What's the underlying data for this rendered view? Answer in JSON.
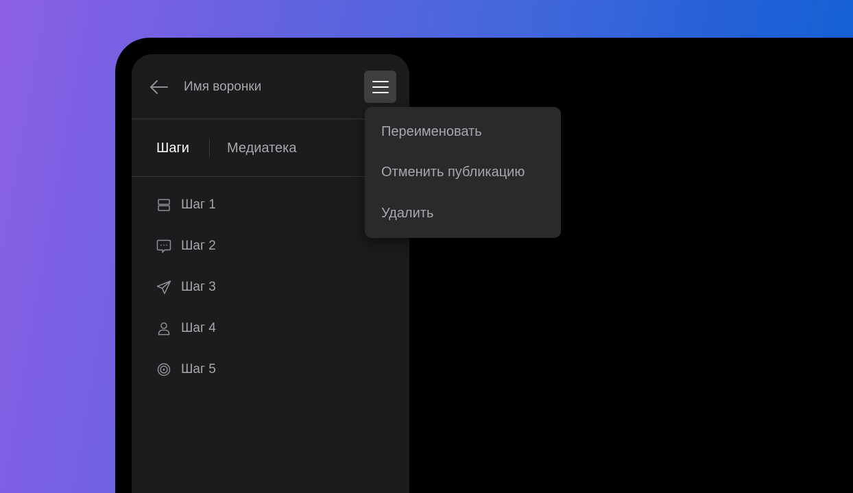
{
  "header": {
    "back_icon": "arrow-left-icon",
    "title": "Имя воронки",
    "menu_icon": "hamburger-menu-icon"
  },
  "tabs": [
    {
      "label": "Шаги",
      "active": true
    },
    {
      "label": "Медиатека",
      "active": false
    }
  ],
  "steps": [
    {
      "label": "Шаг 1",
      "icon": "layout-rows-icon"
    },
    {
      "label": "Шаг 2",
      "icon": "chat-bubble-icon"
    },
    {
      "label": "Шаг 3",
      "icon": "paper-plane-icon"
    },
    {
      "label": "Шаг 4",
      "icon": "user-icon"
    },
    {
      "label": "Шаг 5",
      "icon": "target-icon"
    }
  ],
  "menu": {
    "items": [
      {
        "label": "Переименовать"
      },
      {
        "label": "Отменить публикацию"
      },
      {
        "label": "Удалить"
      }
    ]
  },
  "colors": {
    "background_gradient_start": "#8c5fe6",
    "background_gradient_end": "#0b62d2",
    "panel": "#1c1c1e",
    "dropdown": "#2a2a2d",
    "menu_button": "#3f3f42",
    "text_primary": "#ffffff",
    "text_secondary": "#a7a7ab"
  }
}
